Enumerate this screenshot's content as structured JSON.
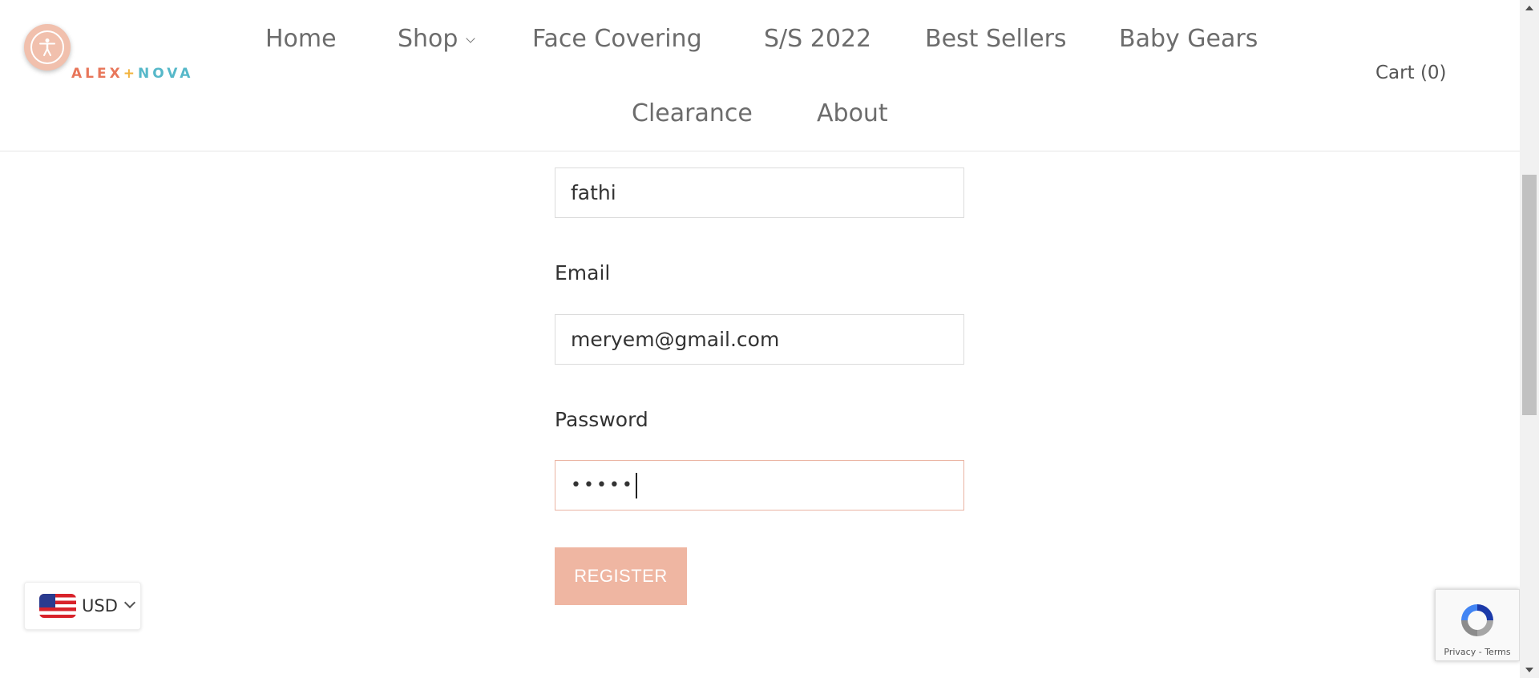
{
  "brand": {
    "logo_part1": "ALEX",
    "logo_plus": "+",
    "logo_part2": "NOVA",
    "colors": {
      "part1": "#e8765a",
      "plus": "#f2b33d",
      "part2": "#56b8c9",
      "accent": "#efb6a2"
    }
  },
  "accessibility": {
    "icon": "accessibility-person-icon"
  },
  "nav": {
    "items": [
      {
        "label": "Home"
      },
      {
        "label": "Shop",
        "has_dropdown": true
      },
      {
        "label": "Face Covering"
      },
      {
        "label": "S/S 2022"
      },
      {
        "label": "Best Sellers"
      },
      {
        "label": "Baby Gears"
      },
      {
        "label": "Clearance"
      },
      {
        "label": "About"
      }
    ],
    "cart_label": "Cart (0)"
  },
  "form": {
    "name_value": "fathi",
    "email_label": "Email",
    "email_value": "meryem@gmail.com",
    "password_label": "Password",
    "password_value": "•••••",
    "register_label": "REGISTER"
  },
  "currency": {
    "label": "USD",
    "flag": "us-flag-icon"
  },
  "recaptcha": {
    "links": "Privacy - Terms"
  }
}
